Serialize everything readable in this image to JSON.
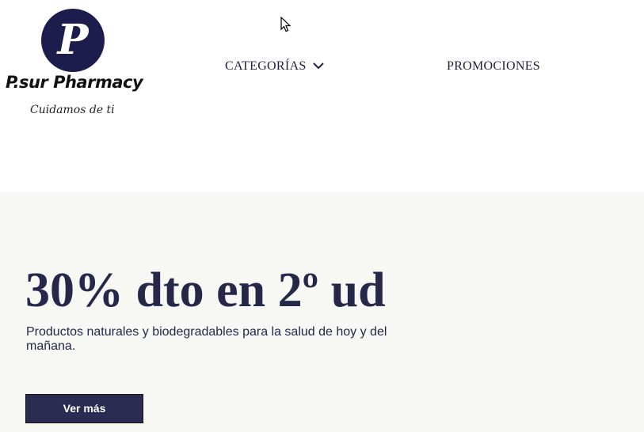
{
  "brand": {
    "logo_letter": "P",
    "name": "P.sur Pharmacy",
    "tagline": "Cuidamos de ti",
    "color": "#1c1c4d"
  },
  "nav": {
    "categorias_label": "CATEGORÍAS",
    "promociones_label": "PROMOCIONES",
    "dropdown_icon": "chevron-down-icon"
  },
  "hero": {
    "title": "30% dto en 2º ud",
    "subtitle": "Productos naturales y biodegradables para la salud de hoy y del mañana.",
    "button_label": "Ver más",
    "background": "#f7f7f3",
    "text_color": "#252849",
    "button_color": "#2a2c52"
  }
}
